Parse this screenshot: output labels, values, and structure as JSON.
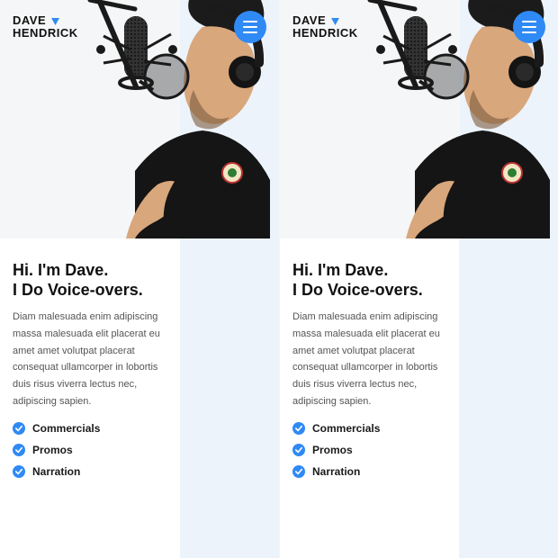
{
  "logo": {
    "line1": "DAVE",
    "line2": "HENDRICK"
  },
  "hero": {
    "heading_line1": "Hi. I'm Dave.",
    "heading_line2": "I Do Voice-overs.",
    "body": "Diam malesuada enim adipiscing massa malesuada elit placerat eu amet amet volutpat placerat consequat ullamcorper in lobortis duis risus viverra lectus nec, adipiscing sapien."
  },
  "features": [
    {
      "label": "Commercials"
    },
    {
      "label": "Promos"
    },
    {
      "label": "Narration"
    }
  ],
  "colors": {
    "accent": "#2f8af5"
  }
}
